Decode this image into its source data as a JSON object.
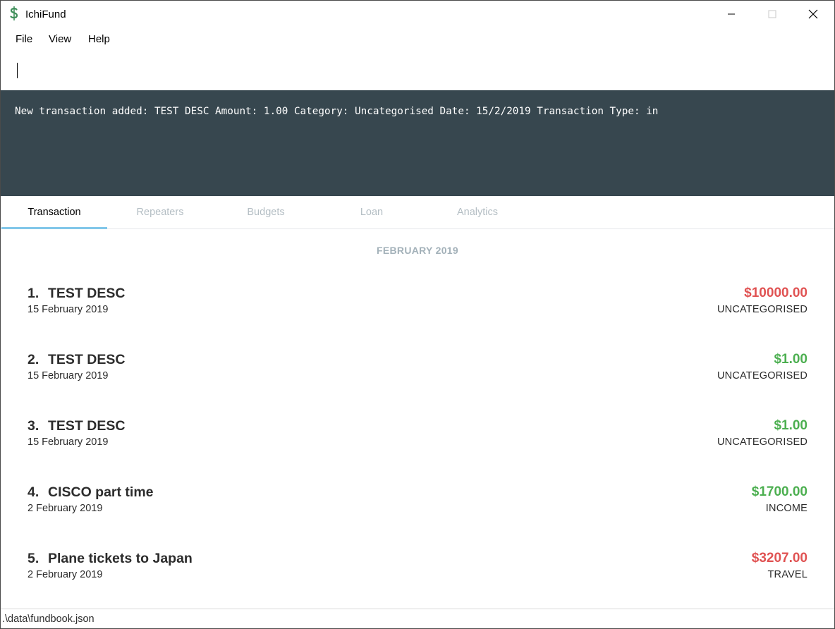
{
  "window": {
    "title": "IchiFund",
    "icon": "dollar-s-icon"
  },
  "menu": {
    "items": [
      "File",
      "View",
      "Help"
    ]
  },
  "command": {
    "value": "",
    "placeholder": ""
  },
  "result": {
    "text": "New transaction added: TEST DESC Amount: 1.00 Category: Uncategorised Date: 15/2/2019 Transaction Type: in"
  },
  "tabs": [
    {
      "label": "Transaction",
      "active": true
    },
    {
      "label": "Repeaters",
      "active": false
    },
    {
      "label": "Budgets",
      "active": false
    },
    {
      "label": "Loan",
      "active": false
    },
    {
      "label": "Analytics",
      "active": false
    }
  ],
  "transactions": {
    "month": "FEBRUARY 2019",
    "items": [
      {
        "index": "1.",
        "description": "TEST DESC",
        "date": "15 February 2019",
        "amount": "$10000.00",
        "category": "UNCATEGORISED",
        "type": "out"
      },
      {
        "index": "2.",
        "description": "TEST DESC",
        "date": "15 February 2019",
        "amount": "$1.00",
        "category": "UNCATEGORISED",
        "type": "in"
      },
      {
        "index": "3.",
        "description": "TEST DESC",
        "date": "15 February 2019",
        "amount": "$1.00",
        "category": "UNCATEGORISED",
        "type": "in"
      },
      {
        "index": "4.",
        "description": "CISCO part time",
        "date": "2 February 2019",
        "amount": "$1700.00",
        "category": "INCOME",
        "type": "in"
      },
      {
        "index": "5.",
        "description": "Plane tickets to Japan",
        "date": "2 February 2019",
        "amount": "$3207.00",
        "category": "TRAVEL",
        "type": "out"
      }
    ]
  },
  "status": {
    "file_path": ".\\data\\fundbook.json"
  },
  "colors": {
    "result_bg": "#37474f",
    "tab_indicator": "#81c7e9",
    "amount_out": "#e05252",
    "amount_in": "#4caf50"
  }
}
